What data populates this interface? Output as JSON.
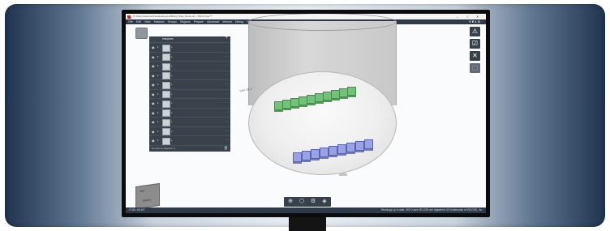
{
  "window": {
    "title": "C:\\Users\\VeloUser\\Desktop\\Layout\\Build_Plate_Demo.vlo - VELO Flow™",
    "controls": [
      "–",
      "□",
      "✕"
    ]
  },
  "menu": {
    "items": [
      "File",
      "Edit",
      "View",
      "Instance",
      "Groups",
      "Regions",
      "Prepare",
      "Advanced",
      "Internal",
      "Debug",
      "Help"
    ],
    "brand": "VELO"
  },
  "panel": {
    "title": "Instances",
    "add_label": "+",
    "rows": [
      {
        "name": "L"
      },
      {
        "name": "L"
      },
      {
        "name": "L"
      },
      {
        "name": "L"
      },
      {
        "name": "L"
      },
      {
        "name": "L"
      },
      {
        "name": "L"
      },
      {
        "name": "L"
      },
      {
        "name": "L"
      },
      {
        "name": "L"
      },
      {
        "name": "L"
      }
    ],
    "footer_label": "Groups by Regions: 4",
    "trash_icon": "trash-icon"
  },
  "viewport": {
    "part_tag": "Y3S7 20L 8",
    "navcube": {
      "face_top": "TOP",
      "face_front": "FRONT"
    },
    "right_tools": [
      {
        "icon": "warning-icon",
        "glyph": "⚠"
      },
      {
        "icon": "checklist-icon",
        "glyph": "☑"
      },
      {
        "icon": "close-icon",
        "glyph": "✕"
      },
      {
        "icon": "placeholder-icon",
        "glyph": "▢"
      }
    ],
    "bottom_tools": [
      {
        "icon": "fit-view-icon",
        "glyph": "⊕"
      },
      {
        "icon": "cube-view-icon",
        "glyph": "⬡"
      },
      {
        "icon": "settings-icon",
        "glyph": "⚙"
      },
      {
        "icon": "layers-icon",
        "glyph": "◈"
      }
    ]
  },
  "statusbar": {
    "left": "ITUEL 48 407",
    "right": "Warnings up to date. VELO and VELO3D are registered US trademarks of VELO3D, Inc."
  },
  "colors": {
    "green_parts": "#73c17a",
    "purple_parts": "#9aa2e4",
    "menubar": "#2f3a48",
    "panel": "#39414b"
  }
}
